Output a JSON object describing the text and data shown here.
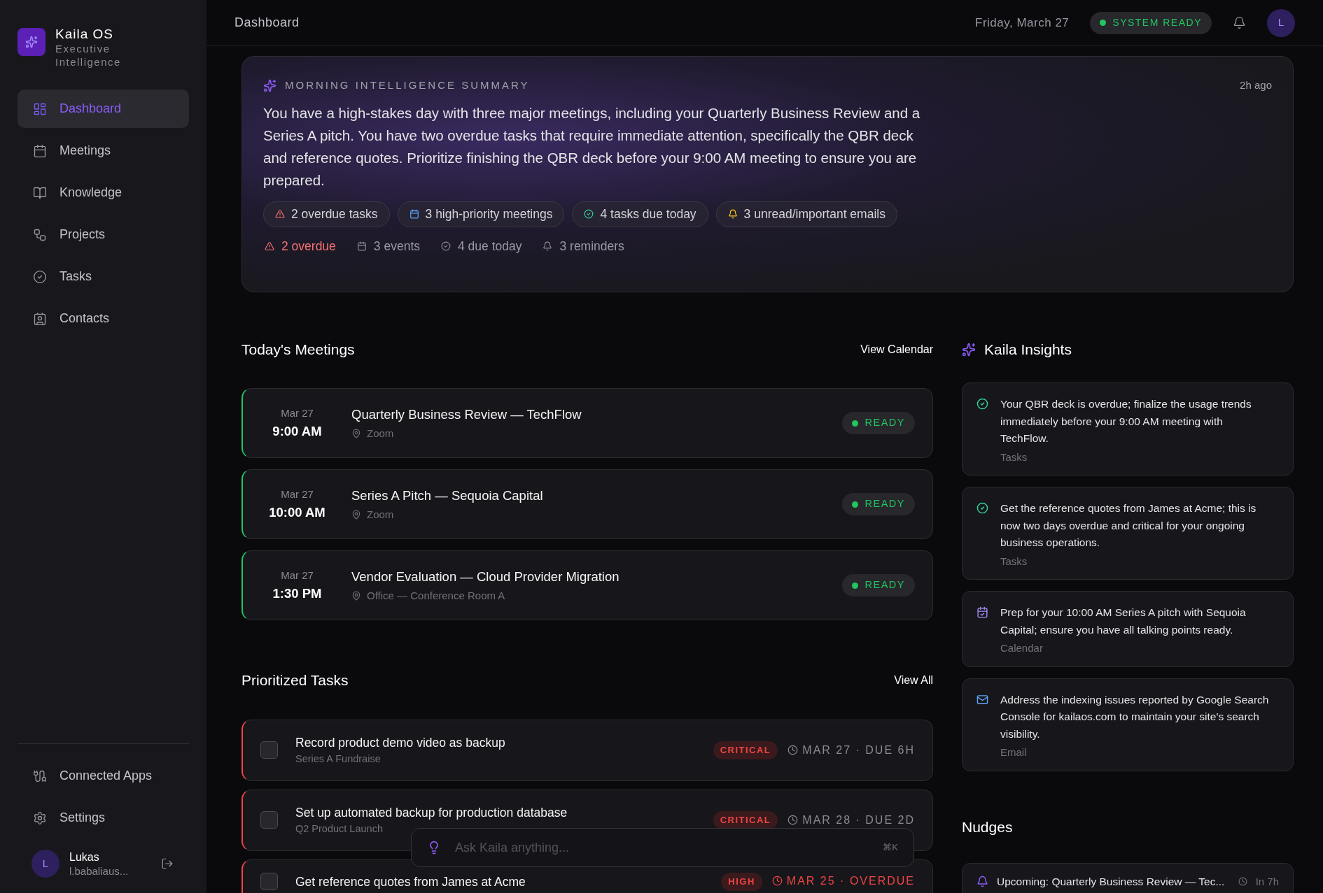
{
  "brand": {
    "name": "Kaila OS",
    "tagline": "Executive Intelligence"
  },
  "sidebar": {
    "items": [
      {
        "label": "Dashboard",
        "selected": true
      },
      {
        "label": "Meetings",
        "selected": false
      },
      {
        "label": "Knowledge",
        "selected": false
      },
      {
        "label": "Projects",
        "selected": false
      },
      {
        "label": "Tasks",
        "selected": false
      },
      {
        "label": "Contacts",
        "selected": false
      }
    ],
    "bottom_items": [
      {
        "label": "Connected Apps"
      },
      {
        "label": "Settings"
      }
    ],
    "user": {
      "initial": "L",
      "name": "Lukas",
      "email": "l.babaliaus..."
    }
  },
  "header": {
    "title": "Dashboard",
    "date": "Friday, March 27",
    "status": "SYSTEM READY",
    "avatar": "L"
  },
  "summary": {
    "title": "MORNING INTELLIGENCE SUMMARY",
    "time": "2h ago",
    "text": "You have a high-stakes day with three major meetings, including your Quarterly Business Review and a Series A pitch. You have two overdue tasks that require immediate attention, specifically the QBR deck and reference quotes. Prioritize finishing the QBR deck before your 9:00 AM meeting to ensure you are prepared.",
    "chips": [
      {
        "kind": "alert",
        "label": "2 overdue tasks"
      },
      {
        "kind": "calendar",
        "label": "3 high-priority meetings"
      },
      {
        "kind": "task",
        "label": "4 tasks due today"
      },
      {
        "kind": "reminder",
        "label": "3 unread/important emails"
      }
    ],
    "stats": [
      {
        "kind": "alert",
        "label": "2 overdue"
      },
      {
        "kind": "calendar",
        "label": "3 events"
      },
      {
        "kind": "task",
        "label": "4 due today"
      },
      {
        "kind": "reminder",
        "label": "3 reminders"
      }
    ]
  },
  "meetings": {
    "title": "Today's Meetings",
    "link": "View Calendar",
    "items": [
      {
        "date": "Mar 27",
        "time": "9:00 AM",
        "title": "Quarterly Business Review — TechFlow",
        "location": "Zoom",
        "status": "READY"
      },
      {
        "date": "Mar 27",
        "time": "10:00 AM",
        "title": "Series A Pitch — Sequoia Capital",
        "location": "Zoom",
        "status": "READY"
      },
      {
        "date": "Mar 27",
        "time": "1:30 PM",
        "title": "Vendor Evaluation — Cloud Provider Migration",
        "location": "Office — Conference Room A",
        "status": "READY"
      }
    ]
  },
  "tasks": {
    "title": "Prioritized Tasks",
    "link": "View All",
    "items": [
      {
        "checked": false,
        "title": "Record product demo video as backup",
        "project": "Series A Fundraise",
        "priority": "CRITICAL",
        "due": "MAR 27 · DUE 6H",
        "overdue": false
      },
      {
        "checked": false,
        "title": "Set up automated backup for production database",
        "project": "Q2 Product Launch",
        "priority": "CRITICAL",
        "due": "MAR 28 · DUE 2D",
        "overdue": false
      },
      {
        "checked": false,
        "title": "Get reference quotes from James at Acme",
        "priority": "HIGH",
        "due": "MAR 25 · OVERDUE",
        "overdue": true
      }
    ]
  },
  "insights": {
    "title": "Kaila Insights",
    "items": [
      {
        "kind": "task",
        "text": "Your QBR deck is overdue; finalize the usage trends immediately before your 9:00 AM meeting with TechFlow.",
        "source": "Tasks"
      },
      {
        "kind": "task",
        "text": "Get the reference quotes from James at Acme; this is now two days overdue and critical for your ongoing business operations.",
        "source": "Tasks"
      },
      {
        "kind": "calendar",
        "text": "Prep for your 10:00 AM Series A pitch with Sequoia Capital; ensure you have all talking points ready.",
        "source": "Calendar"
      },
      {
        "kind": "email",
        "text": "Address the indexing issues reported by Google Search Console for kailaos.com to maintain your site's search visibility.",
        "source": "Email"
      }
    ]
  },
  "nudges": {
    "title": "Nudges",
    "items": [
      {
        "text": "Upcoming: Quarterly Business Review — Tec...",
        "time": "In 7h"
      }
    ]
  },
  "ask": {
    "placeholder": "Ask Kaila anything...",
    "shortcut": "⌘K"
  }
}
